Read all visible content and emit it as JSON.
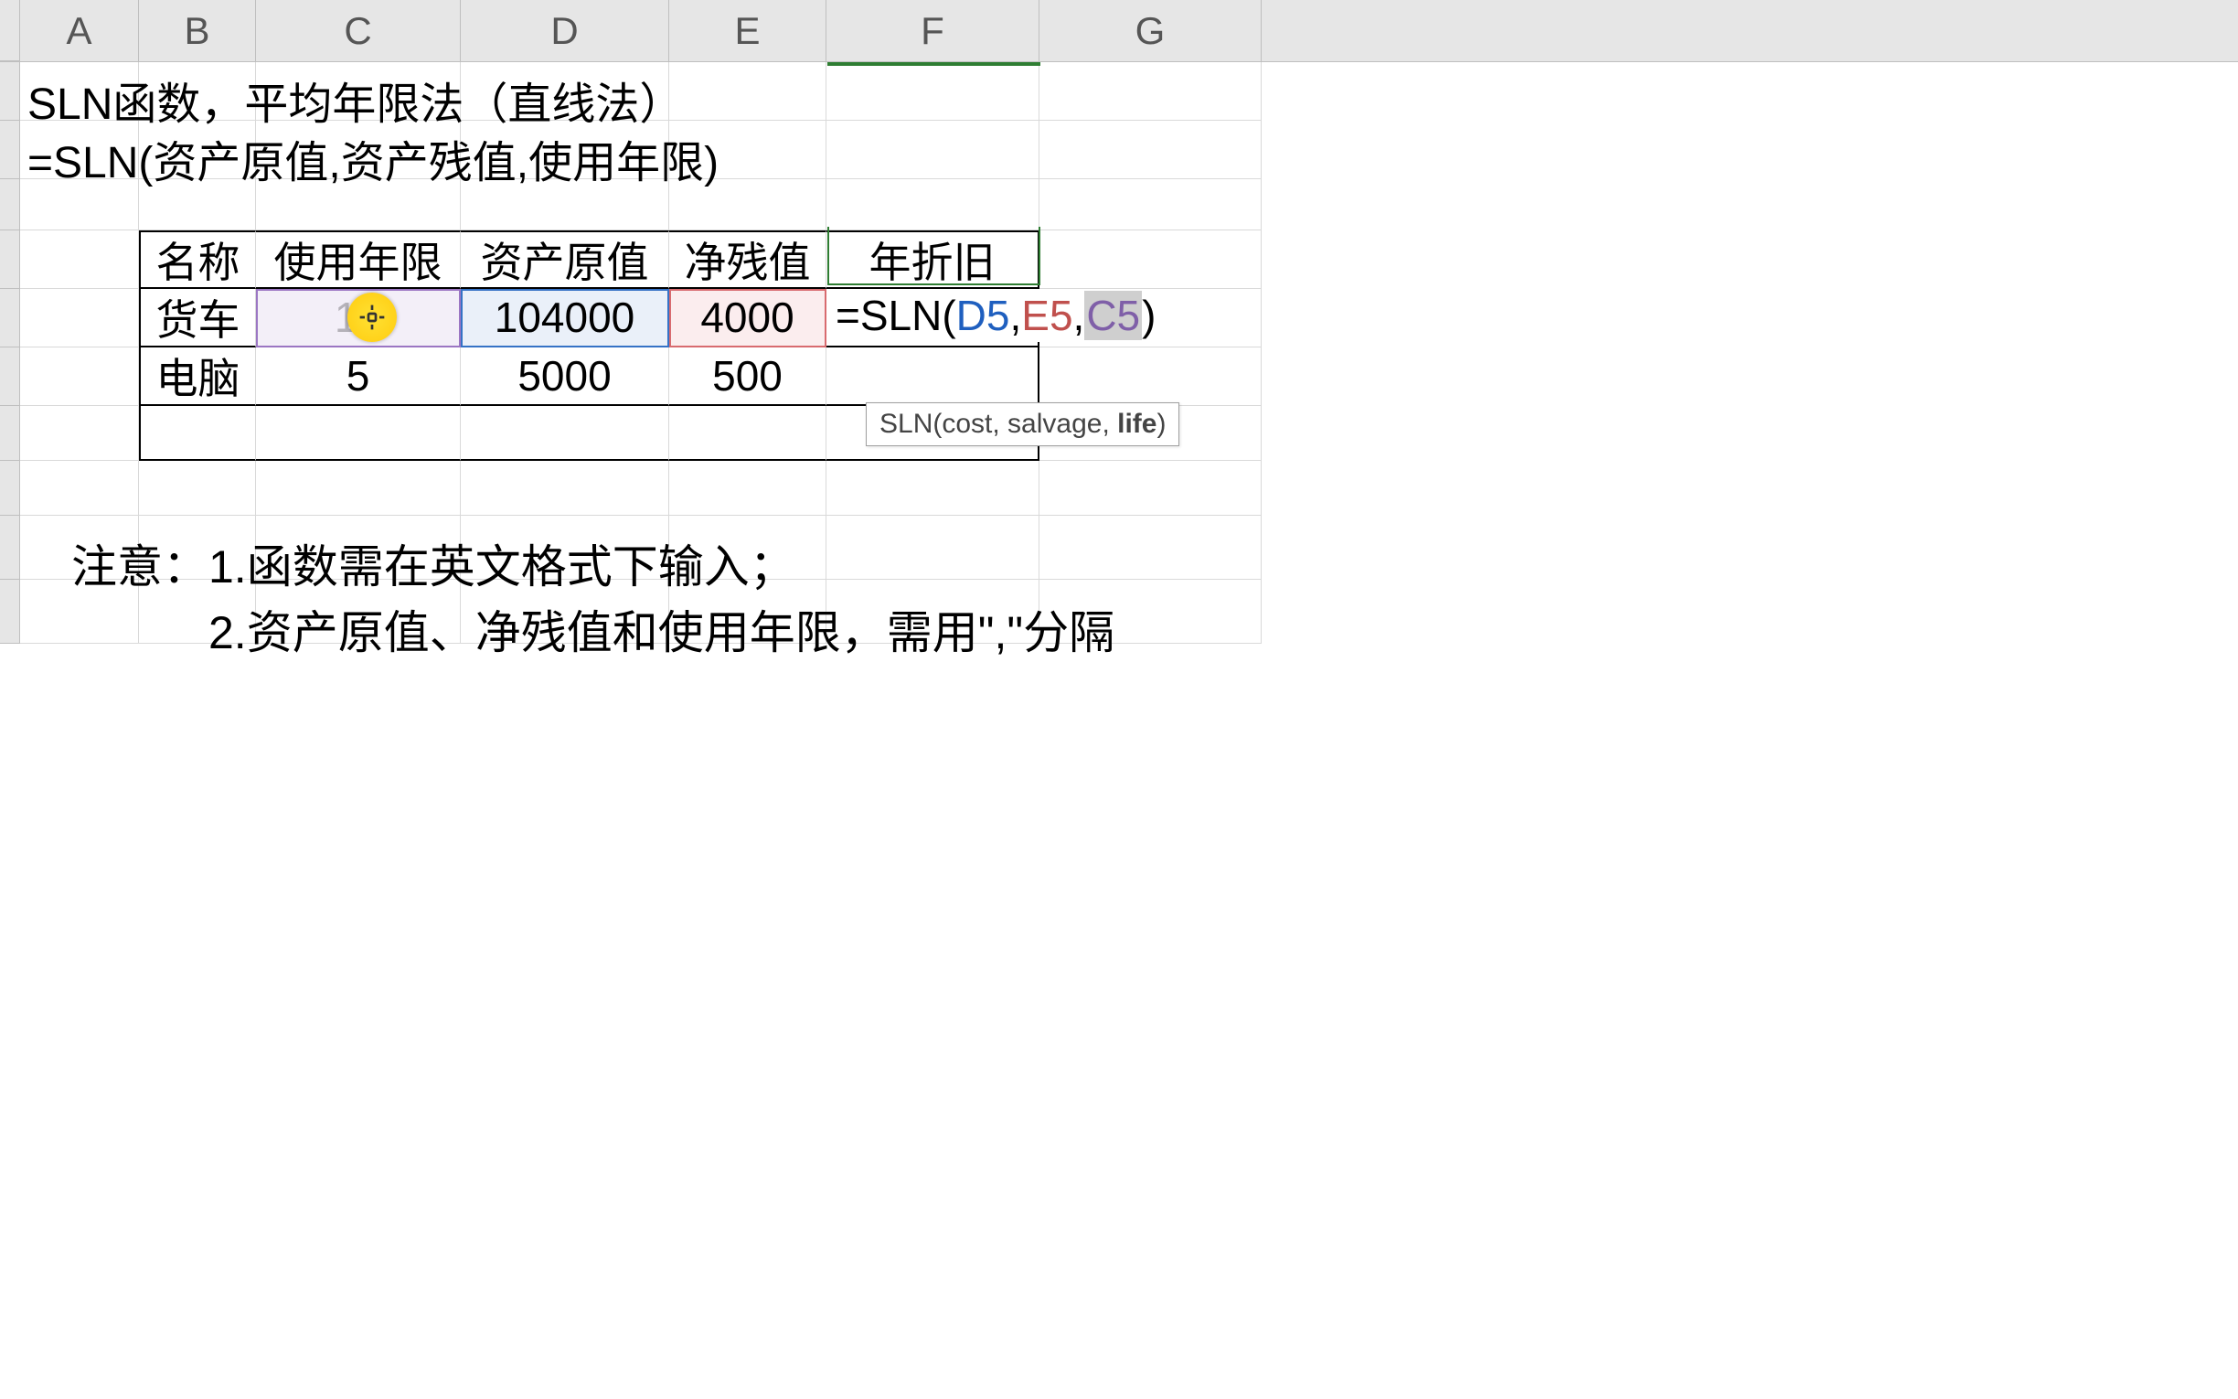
{
  "columns": [
    "A",
    "B",
    "C",
    "D",
    "E",
    "F",
    "G"
  ],
  "row1_text": "SLN函数，平均年限法（直线法）",
  "row2_text": "=SLN(资产原值,资产残值,使用年限)",
  "table": {
    "headers": [
      "名称",
      "使用年限",
      "资产原值",
      "净残值",
      "年折旧"
    ],
    "row5": {
      "name": "货车",
      "life": "10",
      "cost": "104000",
      "salvage": "4000"
    },
    "row6": {
      "name": "电脑",
      "life": "5",
      "cost": "5000",
      "salvage": "500"
    }
  },
  "formula": {
    "prefix": "=SLN(",
    "ref1": "D5",
    "ref2": "E5",
    "ref3": "C5",
    "close": ")"
  },
  "tooltip": {
    "prefix": "SLN(cost, salvage, ",
    "bold": "life",
    "suffix": ")"
  },
  "notes": {
    "line1": "注意：1.函数需在英文格式下输入；",
    "line2_indent": "2.资产原值、净残值和使用年限，需用\",\"分隔"
  }
}
